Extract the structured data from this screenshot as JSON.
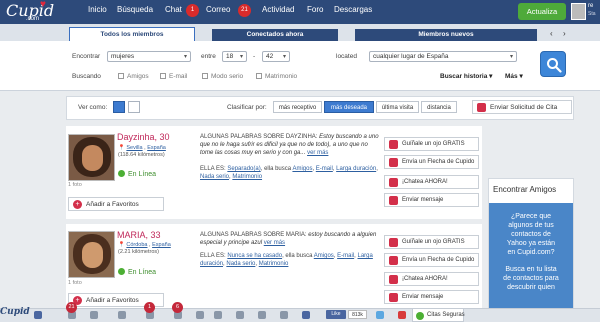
{
  "brand": {
    "logo": "Cupid",
    "logo_sub": ".com",
    "bottom_logo": "Cupid"
  },
  "nav": {
    "items": [
      "Inicio",
      "Búsqueda",
      "Chat",
      "Correo",
      "Actividad",
      "Foro",
      "Descargas"
    ],
    "chat_badge": "1",
    "mail_badge": "21",
    "update_label": "Actualiza",
    "user_name": "re",
    "user_status": "Sta"
  },
  "tabs": {
    "items": [
      "Todos los miembros",
      "Conectados ahora",
      "Miembros nuevos"
    ],
    "active": 0,
    "prev": "‹",
    "next": "›"
  },
  "search": {
    "find_label": "Encontrar",
    "find_value": "mujeres",
    "between_label": "entre",
    "age_from": "18",
    "age_to": "42",
    "located_label": "located",
    "location_value": "cualquier lugar de España",
    "looking_label": "Buscando",
    "checkboxes": [
      "Amigos",
      "E-mail",
      "Modo serio",
      "Matrimonio"
    ],
    "advanced_label": "Buscar historia",
    "more_label": "Más"
  },
  "view": {
    "view_label": "Ver como:",
    "sort_label": "Clasificar por:",
    "sort_options": [
      "más receptivo",
      "más deseada",
      "última visita",
      "distancia"
    ],
    "sort_active": 1,
    "send_label": "Enviar Solicitud de Cita"
  },
  "profiles": [
    {
      "name": "Dayzinha, 30",
      "location": [
        "Sevilla",
        "España",
        "(118.64 kilómetros)"
      ],
      "online": "En Línea",
      "photos": "1 foto",
      "fav": "Añadir a Favoritos",
      "about_head": "ALGUNAS PALABRAS SOBRE DAYZINHA:",
      "about_text": "Estoy buscando a uno que no le haga sufrir es dificil ya que no de todo), a uno que no tome las cosas muy en serio y con ga...",
      "more": "ver más",
      "she_head": "ELLA ES:",
      "she_text": [
        "Separado(a)",
        "ella busca",
        "Amigos",
        "E-mail",
        "Larga duración",
        "Nada serio",
        "Matrimonio"
      ]
    },
    {
      "name": "MARIA, 33",
      "location": [
        "Córdoba",
        "España",
        "(2.21 kilómetros)"
      ],
      "online": "En Línea",
      "photos": "1 foto",
      "fav": "Añadir a Favoritos",
      "about_head": "ALGUNAS PALABRAS SOBRE MARIA:",
      "about_text": "estoy buscando a alguien especial y principe azul",
      "more": "ver más",
      "she_head": "ELLA ES:",
      "she_text": [
        "Nunca se ha casado",
        "ella busca",
        "Amigos",
        "E-mail",
        "Larga duración",
        "Nada serio",
        "Matrimonio"
      ]
    }
  ],
  "actions": [
    "Guíñale un ojo GRATIS",
    "Envía un Flecha de Cupido",
    "¡Chatea AHORA!",
    "Enviar mensaje"
  ],
  "ad": {
    "title": "Encontrar Amigos",
    "lines": [
      "¿Parece que",
      "algunos de tus",
      "contactos de",
      "Yahoo ya están",
      "en Cupid.com?",
      "",
      "Busca en tu lista",
      "de contactos para",
      "descubrir quien"
    ]
  },
  "bottombar": {
    "badges": [
      "21",
      "1",
      "6"
    ],
    "fb_like": "Like",
    "fb_count": "813k",
    "safe_label": "Citas Seguras"
  },
  "colors": {
    "header": "#2d4a7a",
    "accent": "#3d7bd0",
    "pink": "#c0285a",
    "green": "#4eaa3a"
  }
}
